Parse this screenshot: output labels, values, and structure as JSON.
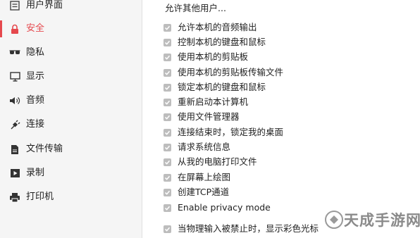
{
  "sidebar": {
    "items": [
      {
        "label": "用户界面",
        "icon": "list-icon",
        "active": false
      },
      {
        "label": "安全",
        "icon": "lock-icon",
        "active": true
      },
      {
        "label": "隐私",
        "icon": "glasses-icon",
        "active": false
      },
      {
        "label": "显示",
        "icon": "monitor-icon",
        "active": false
      },
      {
        "label": "音频",
        "icon": "speaker-icon",
        "active": false
      },
      {
        "label": "连接",
        "icon": "plug-icon",
        "active": false
      },
      {
        "label": "文件传输",
        "icon": "file-icon",
        "active": false
      },
      {
        "label": "录制",
        "icon": "record-icon",
        "active": false
      },
      {
        "label": "打印机",
        "icon": "printer-icon",
        "active": false
      }
    ]
  },
  "main": {
    "section_title": "允许其他用户...",
    "permissions": [
      {
        "label": "允许本机的音频输出",
        "checked": true
      },
      {
        "label": "控制本机的键盘和鼠标",
        "checked": true
      },
      {
        "label": "使用本机的剪贴板",
        "checked": true
      },
      {
        "label": "使用本机的剪贴板传输文件",
        "checked": true
      },
      {
        "label": "锁定本机的键盘和鼠标",
        "checked": true
      },
      {
        "label": "重新启动本计算机",
        "checked": true
      },
      {
        "label": "使用文件管理器",
        "checked": true
      },
      {
        "label": "连接结束时，锁定我的桌面",
        "checked": true
      },
      {
        "label": "请求系统信息",
        "checked": true
      },
      {
        "label": "从我的电脑打印文件",
        "checked": true
      },
      {
        "label": "在屏幕上绘图",
        "checked": true
      },
      {
        "label": "创建TCP通道",
        "checked": true
      },
      {
        "label": "Enable privacy mode",
        "checked": true
      },
      {
        "label": "当物理输入被禁止时，显示彩色光标",
        "checked": true
      }
    ]
  },
  "watermark": {
    "text": "天成手游网"
  },
  "colors": {
    "accent": "#e5484d",
    "checkbox": "#bdbdbd",
    "sidebar_bg": "#f5f5f5"
  }
}
